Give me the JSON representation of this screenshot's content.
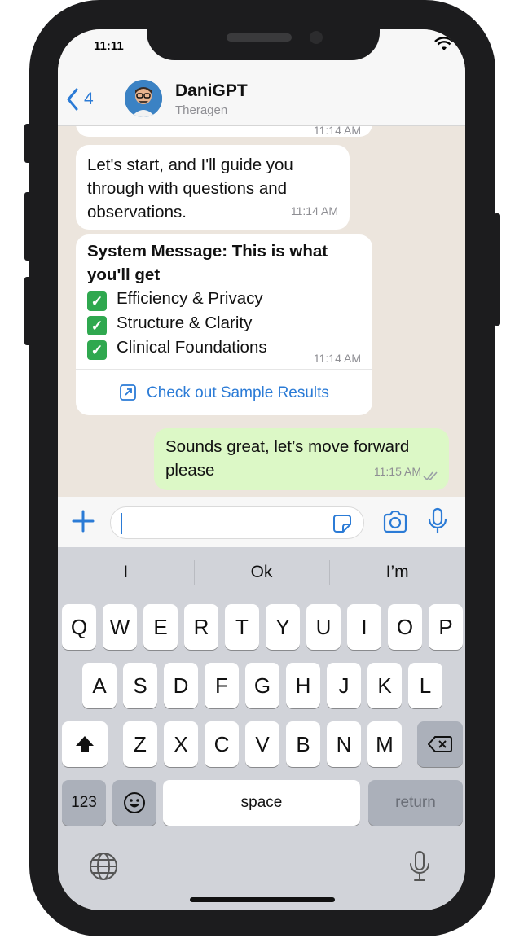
{
  "status": {
    "time": "11:11"
  },
  "header": {
    "back_count": "4",
    "title": "DaniGPT",
    "subtitle": "Theragen"
  },
  "messages": [
    {
      "id": "partial",
      "time": "11:14 AM"
    },
    {
      "id": "m1",
      "text_lines": [
        "Let's start, and I'll guide you",
        "through with questions and",
        "observations."
      ],
      "time": "11:14 AM"
    },
    {
      "id": "m2",
      "heading_lines": [
        "System Message: This is what",
        "you'll get"
      ],
      "items": [
        "Efficiency & Privacy",
        "Structure & Clarity",
        "Clinical Foundations"
      ],
      "time": "11:14 AM",
      "link": "Check out Sample Results"
    },
    {
      "id": "m3",
      "text_lines": [
        "Sounds great, let’s move forward",
        "please"
      ],
      "time": "11:15 AM"
    }
  ],
  "keyboard": {
    "suggestions": [
      "I",
      "Ok",
      "I’m"
    ],
    "row1": [
      "Q",
      "W",
      "E",
      "R",
      "T",
      "Y",
      "U",
      "I",
      "O",
      "P"
    ],
    "row2": [
      "A",
      "S",
      "D",
      "F",
      "G",
      "H",
      "J",
      "K",
      "L"
    ],
    "row3": [
      "Z",
      "X",
      "C",
      "V",
      "B",
      "N",
      "M"
    ],
    "numbers": "123",
    "space": "space",
    "return": "return"
  },
  "colors": {
    "accent": "#2b7bd6",
    "outgoing_bubble": "#dcf8c6",
    "chat_bg": "#ece5dd",
    "check": "#2fa84f"
  }
}
